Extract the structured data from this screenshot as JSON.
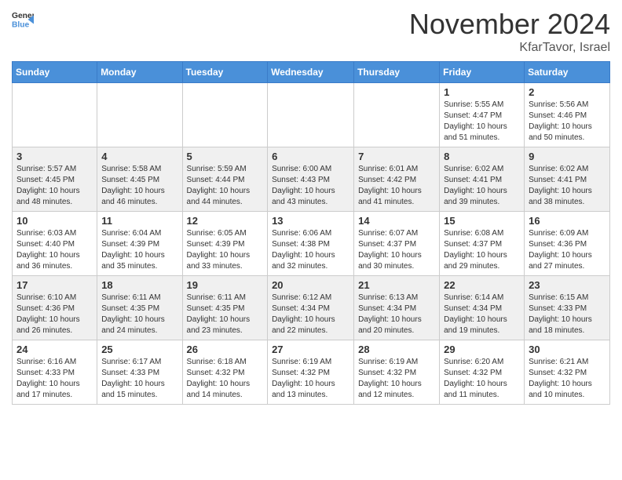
{
  "header": {
    "logo_general": "General",
    "logo_blue": "Blue",
    "month": "November 2024",
    "location": "KfarTavor, Israel"
  },
  "calendar": {
    "weekdays": [
      "Sunday",
      "Monday",
      "Tuesday",
      "Wednesday",
      "Thursday",
      "Friday",
      "Saturday"
    ],
    "weeks": [
      [
        {
          "day": "",
          "info": ""
        },
        {
          "day": "",
          "info": ""
        },
        {
          "day": "",
          "info": ""
        },
        {
          "day": "",
          "info": ""
        },
        {
          "day": "",
          "info": ""
        },
        {
          "day": "1",
          "info": "Sunrise: 5:55 AM\nSunset: 4:47 PM\nDaylight: 10 hours\nand 51 minutes."
        },
        {
          "day": "2",
          "info": "Sunrise: 5:56 AM\nSunset: 4:46 PM\nDaylight: 10 hours\nand 50 minutes."
        }
      ],
      [
        {
          "day": "3",
          "info": "Sunrise: 5:57 AM\nSunset: 4:45 PM\nDaylight: 10 hours\nand 48 minutes."
        },
        {
          "day": "4",
          "info": "Sunrise: 5:58 AM\nSunset: 4:45 PM\nDaylight: 10 hours\nand 46 minutes."
        },
        {
          "day": "5",
          "info": "Sunrise: 5:59 AM\nSunset: 4:44 PM\nDaylight: 10 hours\nand 44 minutes."
        },
        {
          "day": "6",
          "info": "Sunrise: 6:00 AM\nSunset: 4:43 PM\nDaylight: 10 hours\nand 43 minutes."
        },
        {
          "day": "7",
          "info": "Sunrise: 6:01 AM\nSunset: 4:42 PM\nDaylight: 10 hours\nand 41 minutes."
        },
        {
          "day": "8",
          "info": "Sunrise: 6:02 AM\nSunset: 4:41 PM\nDaylight: 10 hours\nand 39 minutes."
        },
        {
          "day": "9",
          "info": "Sunrise: 6:02 AM\nSunset: 4:41 PM\nDaylight: 10 hours\nand 38 minutes."
        }
      ],
      [
        {
          "day": "10",
          "info": "Sunrise: 6:03 AM\nSunset: 4:40 PM\nDaylight: 10 hours\nand 36 minutes."
        },
        {
          "day": "11",
          "info": "Sunrise: 6:04 AM\nSunset: 4:39 PM\nDaylight: 10 hours\nand 35 minutes."
        },
        {
          "day": "12",
          "info": "Sunrise: 6:05 AM\nSunset: 4:39 PM\nDaylight: 10 hours\nand 33 minutes."
        },
        {
          "day": "13",
          "info": "Sunrise: 6:06 AM\nSunset: 4:38 PM\nDaylight: 10 hours\nand 32 minutes."
        },
        {
          "day": "14",
          "info": "Sunrise: 6:07 AM\nSunset: 4:37 PM\nDaylight: 10 hours\nand 30 minutes."
        },
        {
          "day": "15",
          "info": "Sunrise: 6:08 AM\nSunset: 4:37 PM\nDaylight: 10 hours\nand 29 minutes."
        },
        {
          "day": "16",
          "info": "Sunrise: 6:09 AM\nSunset: 4:36 PM\nDaylight: 10 hours\nand 27 minutes."
        }
      ],
      [
        {
          "day": "17",
          "info": "Sunrise: 6:10 AM\nSunset: 4:36 PM\nDaylight: 10 hours\nand 26 minutes."
        },
        {
          "day": "18",
          "info": "Sunrise: 6:11 AM\nSunset: 4:35 PM\nDaylight: 10 hours\nand 24 minutes."
        },
        {
          "day": "19",
          "info": "Sunrise: 6:11 AM\nSunset: 4:35 PM\nDaylight: 10 hours\nand 23 minutes."
        },
        {
          "day": "20",
          "info": "Sunrise: 6:12 AM\nSunset: 4:34 PM\nDaylight: 10 hours\nand 22 minutes."
        },
        {
          "day": "21",
          "info": "Sunrise: 6:13 AM\nSunset: 4:34 PM\nDaylight: 10 hours\nand 20 minutes."
        },
        {
          "day": "22",
          "info": "Sunrise: 6:14 AM\nSunset: 4:34 PM\nDaylight: 10 hours\nand 19 minutes."
        },
        {
          "day": "23",
          "info": "Sunrise: 6:15 AM\nSunset: 4:33 PM\nDaylight: 10 hours\nand 18 minutes."
        }
      ],
      [
        {
          "day": "24",
          "info": "Sunrise: 6:16 AM\nSunset: 4:33 PM\nDaylight: 10 hours\nand 17 minutes."
        },
        {
          "day": "25",
          "info": "Sunrise: 6:17 AM\nSunset: 4:33 PM\nDaylight: 10 hours\nand 15 minutes."
        },
        {
          "day": "26",
          "info": "Sunrise: 6:18 AM\nSunset: 4:32 PM\nDaylight: 10 hours\nand 14 minutes."
        },
        {
          "day": "27",
          "info": "Sunrise: 6:19 AM\nSunset: 4:32 PM\nDaylight: 10 hours\nand 13 minutes."
        },
        {
          "day": "28",
          "info": "Sunrise: 6:19 AM\nSunset: 4:32 PM\nDaylight: 10 hours\nand 12 minutes."
        },
        {
          "day": "29",
          "info": "Sunrise: 6:20 AM\nSunset: 4:32 PM\nDaylight: 10 hours\nand 11 minutes."
        },
        {
          "day": "30",
          "info": "Sunrise: 6:21 AM\nSunset: 4:32 PM\nDaylight: 10 hours\nand 10 minutes."
        }
      ]
    ]
  }
}
